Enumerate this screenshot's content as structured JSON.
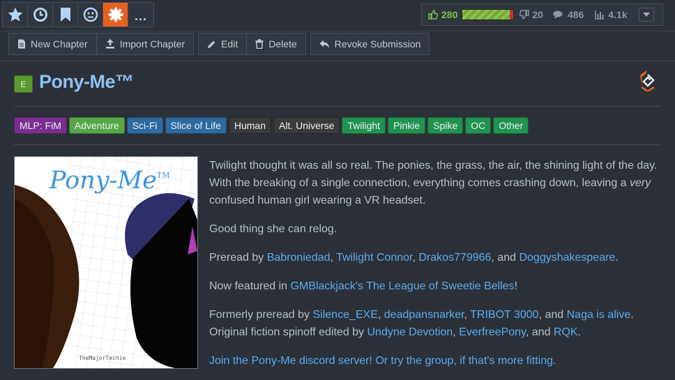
{
  "topbar": {
    "icons": [
      "star-icon",
      "clock-icon",
      "bookmark-icon",
      "neutral-face-icon",
      "sun-gear-icon",
      "more-icon"
    ],
    "more_label": "...",
    "likes": "280",
    "like_ratio": 0.93,
    "dislikes": "20",
    "comments": "486",
    "views": "4.1k"
  },
  "toolbar": {
    "new_chapter": "New Chapter",
    "import_chapter": "Import Chapter",
    "edit": "Edit",
    "delete": "Delete",
    "revoke": "Revoke Submission"
  },
  "story": {
    "rating": "E",
    "title": "Pony-Me™",
    "tags": [
      {
        "label": "MLP: FiM",
        "color": "#7a2e8f"
      },
      {
        "label": "Adventure",
        "color": "#57a747"
      },
      {
        "label": "Sci-Fi",
        "color": "#2e6aa0"
      },
      {
        "label": "Slice of Life",
        "color": "#2e6aa0"
      },
      {
        "label": "Human",
        "color": "#3a3a3a"
      },
      {
        "label": "Alt. Universe",
        "color": "#3a3a3a"
      },
      {
        "label": "Twilight",
        "color": "#21924f"
      },
      {
        "label": "Pinkie",
        "color": "#21924f"
      },
      {
        "label": "Spike",
        "color": "#21924f"
      },
      {
        "label": "OC",
        "color": "#21924f"
      },
      {
        "label": "Other",
        "color": "#21924f"
      }
    ]
  },
  "cover": {
    "title": "Pony-Me",
    "tm": "TM",
    "credit": "TheMajorTechie"
  },
  "description": {
    "p1_a": "Twilight thought it was all so real. The ponies, the grass, the air, the shining light of the day. With the breaking of a single connection, everything comes crashing down, leaving a ",
    "p1_em": "very",
    "p1_b": " confused human girl wearing a VR headset.",
    "p2": "Good thing she can relog.",
    "p3_prefix": "Preread by ",
    "p3_l1": "Babroniedad",
    "p3_s1": ", ",
    "p3_l2": "Twilight Connor",
    "p3_s2": ", ",
    "p3_l3": "Drakos779966",
    "p3_s3": ", and ",
    "p3_l4": "Doggyshakespeare",
    "p3_end": ".",
    "p4_prefix": "Now featured in ",
    "p4_link": "GMBlackjack's The League of Sweetie Belles",
    "p4_end": "!",
    "p5_prefix": "Formerly preread by ",
    "p5_l1": "Silence_EXE",
    "p5_s1": ", ",
    "p5_l2": "deadpansnarker",
    "p5_s2": ", ",
    "p5_l3": "TRIBOT 3000",
    "p5_s3": ", and ",
    "p5_l4": "Naga is alive",
    "p5_s4": ". Original fiction spinoff edited by ",
    "p5_l5": "Undyne Devotion",
    "p5_s5": ", ",
    "p5_l6": "EverfreePony",
    "p5_s6": ", and ",
    "p5_l7": "RQK",
    "p5_end": ".",
    "p6_link": "Join the Pony-Me discord server! Or try the group, if that's more fitting."
  }
}
